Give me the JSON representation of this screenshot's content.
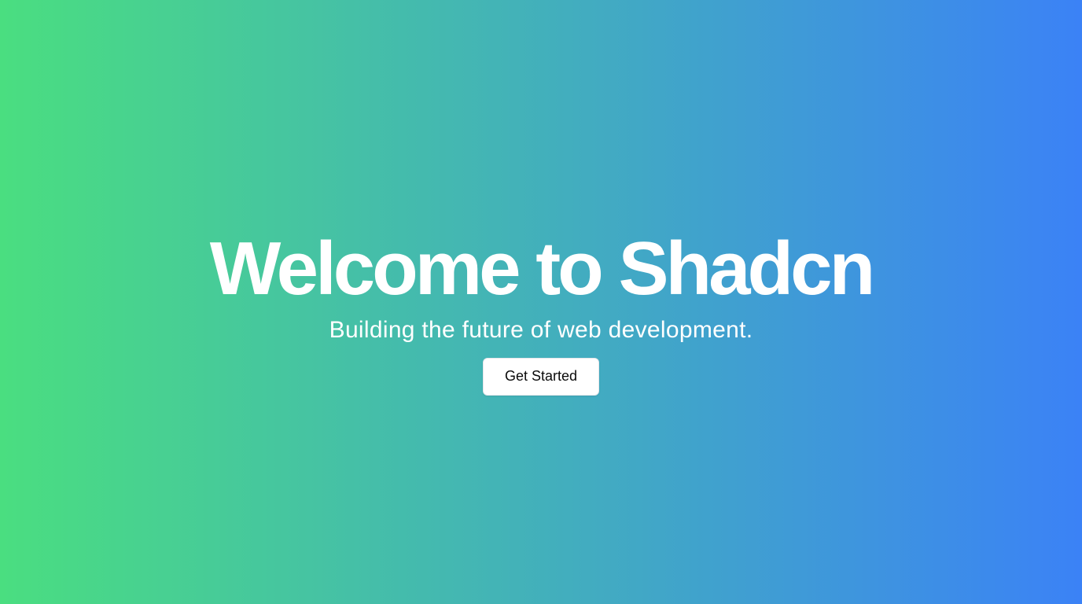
{
  "hero": {
    "title": "Welcome to Shadcn",
    "subtitle": "Building the future of web development.",
    "cta_label": "Get Started"
  },
  "colors": {
    "gradient_start": "#4ade80",
    "gradient_end": "#3b82f6",
    "text": "#ffffff",
    "button_bg": "#ffffff",
    "button_text": "#0a0a0a"
  }
}
